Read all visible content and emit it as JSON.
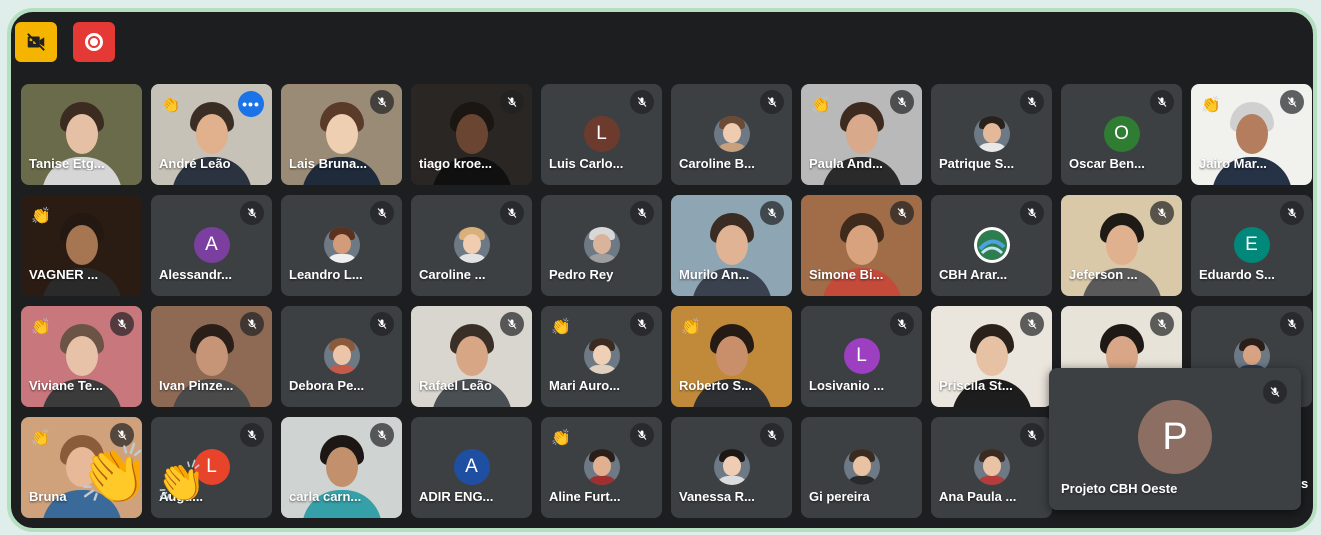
{
  "toolbar": {
    "camera_off_icon": "camera-off-icon",
    "record_icon": "record-icon",
    "camera_color": "#f4b400",
    "record_color": "#e53935"
  },
  "participants": [
    {
      "name": "Tanise Etg...",
      "type": "video",
      "bg": "#6a6b4a",
      "skin": "#e6c0a4",
      "hair": "#3b2b20",
      "shirt": "#d6d6d6",
      "muted": false
    },
    {
      "name": "André Leão",
      "type": "video",
      "bg": "#c7c2b8",
      "skin": "#e1b08c",
      "hair": "#3a2d24",
      "shirt": "#2b3340",
      "muted": false,
      "selected": true,
      "more": true
    },
    {
      "name": "Lais Bruna...",
      "type": "video",
      "bg": "#9a8b76",
      "skin": "#efcfb2",
      "hair": "#5a3a28",
      "shirt": "#1f2a3a",
      "muted": true
    },
    {
      "name": "tiago kroe...",
      "type": "video",
      "bg": "#2a2623",
      "skin": "#6a4632",
      "hair": "#1b1612",
      "shirt": "#101010",
      "muted": true
    },
    {
      "name": "Luis Carlo...",
      "type": "letter",
      "letter": "L",
      "color": "#6d3b2e",
      "muted": true
    },
    {
      "name": "Caroline B...",
      "type": "photo",
      "skin": "#efcbb0",
      "hair": "#6b4b33",
      "shirt": "#c7a07e",
      "muted": true
    },
    {
      "name": "Paula And...",
      "type": "video",
      "bg": "#b9b9b9",
      "skin": "#d8a98b",
      "hair": "#3d2b20",
      "shirt": "#2a2a2a",
      "muted": true
    },
    {
      "name": "Patrique S...",
      "type": "photo",
      "skin": "#e3b999",
      "hair": "#2b211b",
      "shirt": "#e8e8e8",
      "muted": true
    },
    {
      "name": "Oscar Ben...",
      "type": "letter",
      "letter": "O",
      "color": "#2e7d32",
      "muted": true
    },
    {
      "name": "Jairo Mar...",
      "type": "video",
      "bg": "#f1f1ee",
      "skin": "#b47d5e",
      "hair": "#d0d0d0",
      "shirt": "#263245",
      "muted": true
    },
    {
      "name": "VAGNER ...",
      "type": "video",
      "bg": "#2b1c13",
      "skin": "#a67552",
      "hair": "#241812",
      "shirt": "#2a2a2a",
      "muted": false
    },
    {
      "name": "Alessandr...",
      "type": "letter",
      "letter": "A",
      "color": "#7b3fa0",
      "muted": true
    },
    {
      "name": "Leandro L...",
      "type": "photo",
      "skin": "#d29b79",
      "hair": "#5b3220",
      "shirt": "#efefef",
      "muted": true
    },
    {
      "name": "Caroline ...",
      "type": "photo",
      "skin": "#f0cdb1",
      "hair": "#d9b07a",
      "shirt": "#e3e3e3",
      "muted": true
    },
    {
      "name": "Pedro Rey",
      "type": "photo",
      "skin": "#d9b49a",
      "hair": "#d8d8d8",
      "shirt": "#9e9e9e",
      "muted": true
    },
    {
      "name": "Murilo An...",
      "type": "video",
      "bg": "#8ea5b3",
      "skin": "#e1b395",
      "hair": "#3a2c23",
      "shirt": "#3a4250",
      "muted": true
    },
    {
      "name": "Simone Bi...",
      "type": "video",
      "bg": "#a06d48",
      "skin": "#d8a27e",
      "hair": "#402a1c",
      "shirt": "#c44a3a",
      "muted": true
    },
    {
      "name": "CBH Arar...",
      "type": "logo",
      "muted": true
    },
    {
      "name": "Jeferson ...",
      "type": "video",
      "bg": "#d9c9a8",
      "skin": "#e0b18f",
      "hair": "#1e1a16",
      "shirt": "#5a5a5a",
      "muted": true
    },
    {
      "name": "Eduardo S...",
      "type": "letter",
      "letter": "E",
      "color": "#00897b",
      "muted": true
    },
    {
      "name": "Viviane Te...",
      "type": "video",
      "bg": "#c8777d",
      "skin": "#e7c2a8",
      "hair": "#6b5445",
      "shirt": "#3b3b3b",
      "muted": true
    },
    {
      "name": "Ivan Pinze...",
      "type": "video",
      "bg": "#8e6a55",
      "skin": "#c69476",
      "hair": "#2a1f18",
      "shirt": "#4a4a4a",
      "muted": true
    },
    {
      "name": "Debora Pe...",
      "type": "photo",
      "skin": "#ecc5a8",
      "hair": "#8a5a3a",
      "shirt": "#c65a4a",
      "muted": true
    },
    {
      "name": "Rafael Leão",
      "type": "video",
      "bg": "#d9d6cf",
      "skin": "#d6a685",
      "hair": "#3a2f26",
      "shirt": "#4a4f54",
      "muted": true
    },
    {
      "name": "Mari Auro...",
      "type": "photo",
      "skin": "#efcfb6",
      "hair": "#3b2a20",
      "shirt": "#e0d0c0",
      "muted": true
    },
    {
      "name": "Roberto S...",
      "type": "video",
      "bg": "#c08a3a",
      "skin": "#c98f6b",
      "hair": "#241b15",
      "shirt": "#2d2f33",
      "muted": false
    },
    {
      "name": "Losivanio ...",
      "type": "letter",
      "letter": "L",
      "color": "#9c3fc0",
      "muted": true
    },
    {
      "name": "Priscila St...",
      "type": "video",
      "bg": "#ebe6dd",
      "skin": "#e6c1a3",
      "hair": "#2b211b",
      "shirt": "#1d1d1d",
      "muted": true
    },
    {
      "name": "",
      "type": "video",
      "bg": "#e8e3d8",
      "skin": "#d9a787",
      "hair": "#1f1915",
      "shirt": "#5c6066",
      "muted": true
    },
    {
      "name": "",
      "type": "photo",
      "skin": "#d7a383",
      "hair": "#2a1f18",
      "shirt": "#2f3e56",
      "muted": true
    },
    {
      "name": "Bruna",
      "type": "video",
      "bg": "#cfa27b",
      "skin": "#e7b999",
      "hair": "#8a5c3a",
      "shirt": "#3a6a9a",
      "muted": true
    },
    {
      "name": "Augu...",
      "type": "letter",
      "letter": "L",
      "color": "#e8442c",
      "muted": true
    },
    {
      "name": "carla carn...",
      "type": "video",
      "bg": "#cfd4d2",
      "skin": "#c2906c",
      "hair": "#1c1714",
      "shirt": "#35a0a8",
      "muted": true
    },
    {
      "name": "ADIR ENG...",
      "type": "letter",
      "letter": "A",
      "color": "#1f4fa3",
      "muted": false
    },
    {
      "name": "Aline Furt...",
      "type": "photo",
      "skin": "#e0b090",
      "hair": "#2a1f18",
      "shirt": "#a03030",
      "muted": true
    },
    {
      "name": "Vanessa R...",
      "type": "photo",
      "skin": "#efcdb4",
      "hair": "#1d1815",
      "shirt": "#dcdcdc",
      "muted": true
    },
    {
      "name": "Gi pereira",
      "type": "photo",
      "skin": "#e9c1a3",
      "hair": "#3a2b21",
      "shirt": "#2a2a2a",
      "muted": false
    },
    {
      "name": "Ana Paula ...",
      "type": "photo",
      "skin": "#eac3a4",
      "hair": "#3a2a20",
      "shirt": "#b63b3b",
      "muted": true
    },
    {
      "name": "",
      "type": "blank",
      "muted": false
    },
    {
      "name": "",
      "type": "blank",
      "muted": false
    }
  ],
  "floating_tile": {
    "name": "Projeto CBH Oeste",
    "letter": "P",
    "color": "#8d6e63"
  },
  "peek_letter": "s"
}
